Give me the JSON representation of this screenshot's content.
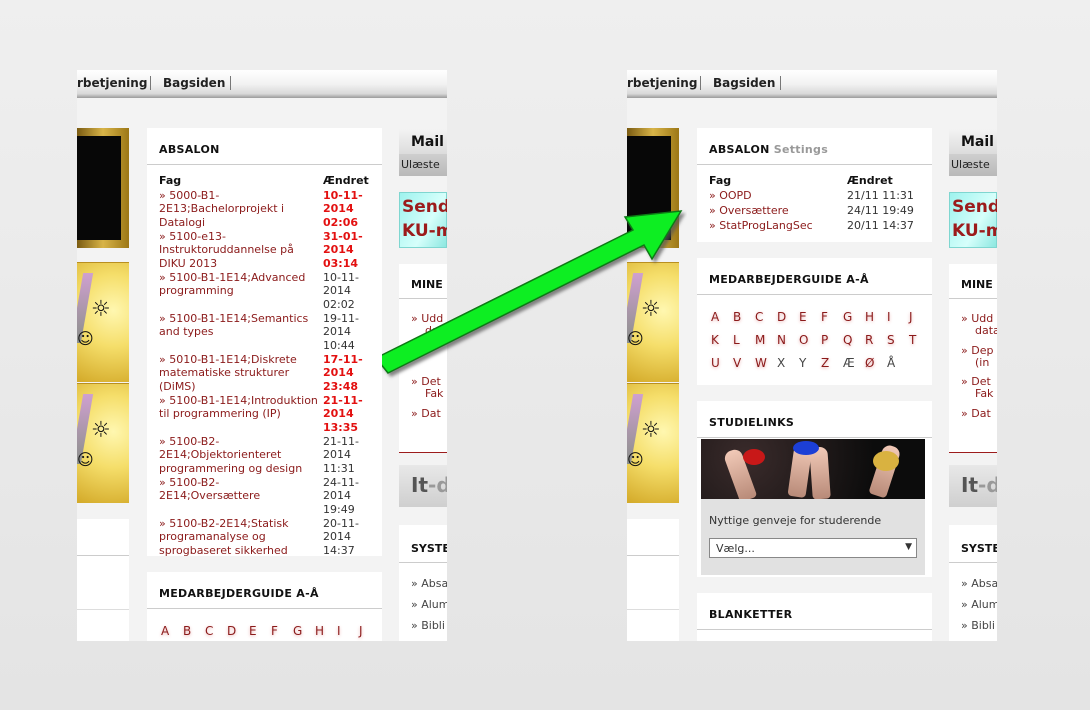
{
  "nav": {
    "item1": "rbetjening",
    "item2": "Bagsiden"
  },
  "left": {
    "absalon": {
      "title": "ABSALON",
      "col_course": "Fag",
      "col_changed": "Ændret",
      "rows": [
        {
          "course": "» 5000-B1-2E13;Bachelorprojekt i Datalogi",
          "date": "10-11-2014 02:06",
          "hot": true
        },
        {
          "course": "» 5100-e13-Instruktoruddannelse på DIKU 2013",
          "date": "31-01-2014 03:14",
          "hot": true
        },
        {
          "course": "» 5100-B1-1E14;Advanced programming",
          "date": "10-11-2014 02:02",
          "hot": false
        },
        {
          "course": "» 5100-B1-1E14;Semantics and types",
          "date": "19-11-2014 10:44",
          "hot": false
        },
        {
          "course": "» 5010-B1-1E14;Diskrete matematiske strukturer (DiMS)",
          "date": "17-11-2014 23:48",
          "hot": true
        },
        {
          "course": "» 5100-B1-1E14;Introduktion til programmering (IP)",
          "date": "21-11-2014 13:35",
          "hot": true
        },
        {
          "course": "» 5100-B2-2E14;Objektorienteret programmering og design",
          "date": "21-11-2014 11:31",
          "hot": false
        },
        {
          "course": "» 5100-B2-2E14;Oversættere",
          "date": "24-11-2014 19:49",
          "hot": false
        },
        {
          "course": "» 5100-B2-2E14;Statisk programanalyse og sprogbaseret sikkerhed",
          "date": "20-11-2014 14:37",
          "hot": false
        }
      ]
    },
    "guide": {
      "title": "MEDARBEJDERGUIDE A-Å",
      "letters": [
        "A",
        "B",
        "C",
        "D",
        "E",
        "F",
        "G",
        "H",
        "I",
        "J"
      ]
    },
    "mail": {
      "title": "Mail",
      "sub": "Ulæste"
    },
    "banner": {
      "line1": "Send",
      "line2": "KU-m"
    },
    "mine": {
      "title": "MINE",
      "items": [
        "» Udd",
        "data",
        "» D",
        "» Det",
        "Fak",
        "» Dat"
      ]
    },
    "itd": {
      "it": "It",
      "rest": "-d"
    },
    "systems": {
      "title": "SYSTE",
      "items": [
        "» Absa",
        "» Alum",
        "» Bibli"
      ]
    }
  },
  "right": {
    "absalon": {
      "title": "ABSALON",
      "settings": "Settings",
      "col_course": "Fag",
      "col_changed": "Ændret",
      "rows": [
        {
          "course": "» OOPD",
          "date": "21/11 11:31"
        },
        {
          "course": "» Oversættere",
          "date": "24/11 19:49"
        },
        {
          "course": "» StatProgLangSec",
          "date": "20/11 14:37"
        }
      ]
    },
    "guide": {
      "title": "MEDARBEJDERGUIDE A-Å",
      "rows": [
        [
          "A",
          "B",
          "C",
          "D",
          "E",
          "F",
          "G",
          "H",
          "I",
          "J"
        ],
        [
          "K",
          "L",
          "M",
          "N",
          "O",
          "P",
          "Q",
          "R",
          "S",
          "T"
        ],
        [
          "U",
          "V",
          "W",
          "X",
          "Y",
          "Z",
          "Æ",
          "Ø",
          "Å"
        ]
      ]
    },
    "studielinks": {
      "title": "STUDIELINKS",
      "caption": "Nyttige genveje for studerende",
      "select_value": "Vælg..."
    },
    "blanketter": {
      "title": "BLANKETTER"
    },
    "mail": {
      "title": "Mail",
      "sub": "Ulæste"
    },
    "banner": {
      "line1": "Send",
      "line2": "KU-m"
    },
    "mine": {
      "title": "MINE",
      "items": [
        "» Udd",
        "data",
        "» Dep",
        "(in",
        "» Det",
        "Fak",
        "» Dat"
      ]
    },
    "itd": {
      "it": "It",
      "rest": "-d"
    },
    "systems": {
      "title": "SYSTE",
      "items": [
        "» Absa",
        "» Alum",
        "» Bibli"
      ]
    }
  },
  "colors": {
    "arrow": "#11ee22",
    "link": "#8b1a1a",
    "hot": "#e31010"
  }
}
